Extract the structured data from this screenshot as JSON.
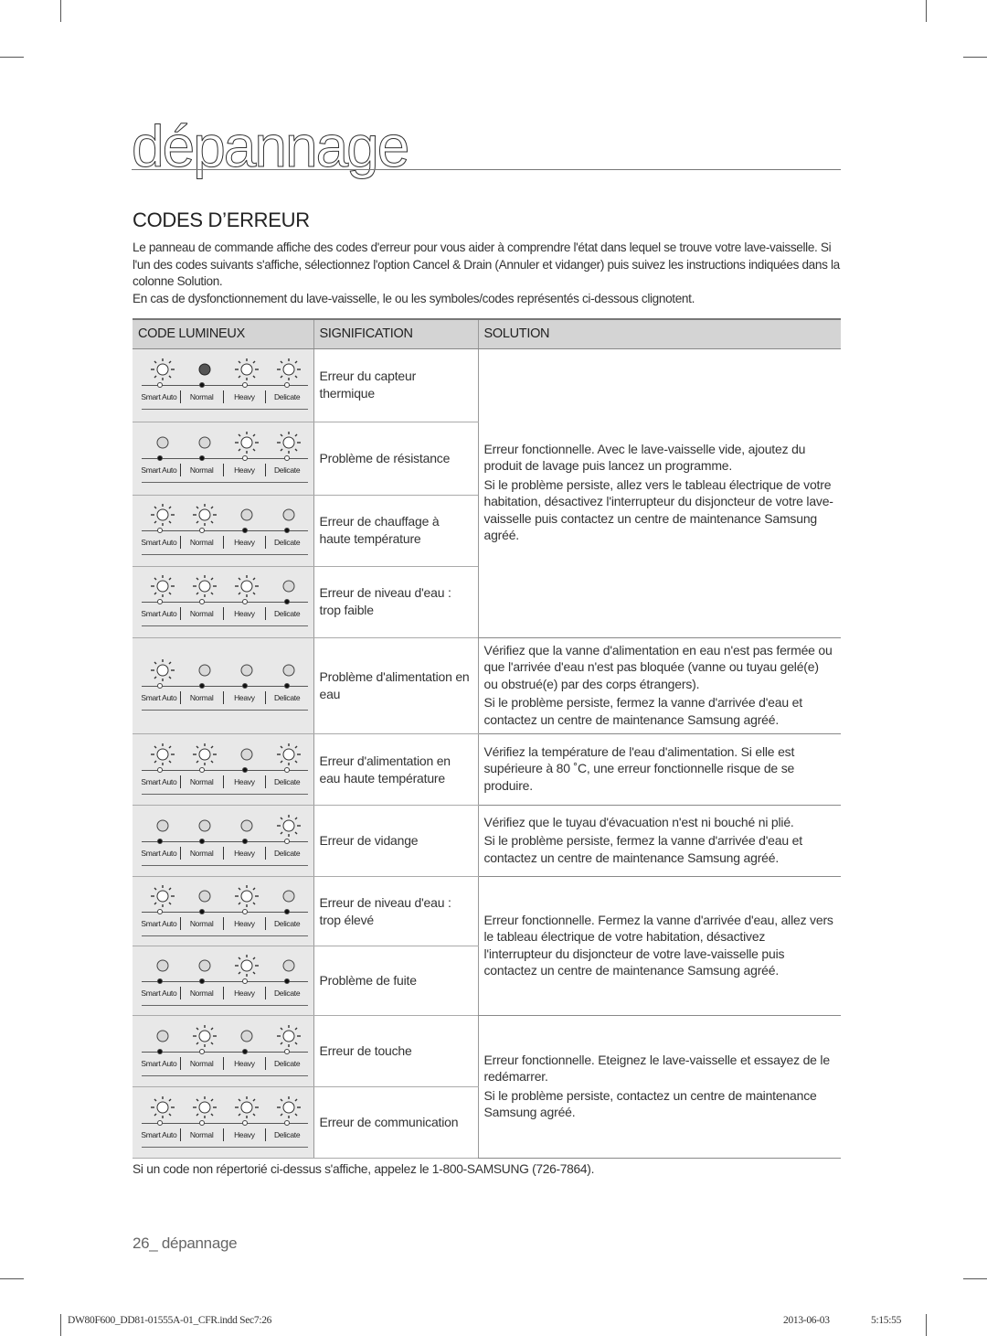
{
  "chapter_title": "dépannage",
  "section_title": "CODES D’ERREUR",
  "intro": [
    "Le panneau de commande affiche des codes d'erreur pour vous aider à comprendre l'état dans lequel se trouve votre lave-vaisselle. Si l'un des codes suivants s'affiche, sélectionnez l'option Cancel & Drain (Annuler et vidanger) puis suivez les instructions indiquées dans la colonne Solution.",
    "En cas de dysfonctionnement du lave-vaisselle, le ou les symboles/codes représentés ci-dessous clignotent."
  ],
  "table": {
    "headers": [
      "CODE LUMINEUX",
      "SIGNIFICATION",
      "SOLUTION"
    ],
    "panel_labels": [
      "Smart Auto",
      "Normal",
      "Heavy",
      "Delicate"
    ],
    "rows": [
      {
        "leds": [
          "blink",
          "on",
          "blink",
          "blink"
        ],
        "meaning": "Erreur du capteur thermique"
      },
      {
        "leds": [
          "off",
          "off",
          "blink",
          "blink"
        ],
        "meaning": "Problème de résistance"
      },
      {
        "leds": [
          "blink",
          "blink",
          "off",
          "off"
        ],
        "meaning": "Erreur de chauffage à haute température"
      },
      {
        "leds": [
          "blink",
          "blink",
          "blink",
          "off"
        ],
        "meaning": "Erreur de niveau d'eau : trop faible"
      },
      {
        "leds": [
          "blink",
          "off",
          "off",
          "off"
        ],
        "meaning": "Problème d'alimentation en eau"
      },
      {
        "leds": [
          "blink",
          "blink",
          "off",
          "blink"
        ],
        "meaning": "Erreur d'alimentation en eau haute température"
      },
      {
        "leds": [
          "off",
          "off",
          "off",
          "blink"
        ],
        "meaning": "Erreur de vidange"
      },
      {
        "leds": [
          "blink",
          "off",
          "blink",
          "off"
        ],
        "meaning": "Erreur de niveau d'eau : trop élevé"
      },
      {
        "leds": [
          "off",
          "off",
          "blink",
          "off"
        ],
        "meaning": "Problème de fuite"
      },
      {
        "leds": [
          "off",
          "blink",
          "off",
          "blink"
        ],
        "meaning": "Erreur de touche"
      },
      {
        "leds": [
          "blink",
          "blink",
          "blink",
          "blink"
        ],
        "meaning": "Erreur de communication"
      }
    ],
    "solutions": [
      {
        "rows": [
          0,
          1,
          2,
          3
        ],
        "paragraphs": [
          "Erreur fonctionnelle. Avec le lave-vaisselle vide, ajoutez du produit de lavage puis lancez un programme.",
          "Si le problème persiste, allez vers le tableau électrique de votre habitation, désactivez l'interrupteur du disjoncteur de votre lave-vaisselle puis contactez un centre de maintenance Samsung agréé."
        ]
      },
      {
        "rows": [
          4
        ],
        "paragraphs": [
          "Vérifiez que la vanne d'alimentation en eau n'est pas fermée ou que l'arrivée d'eau n'est pas bloquée (vanne ou tuyau gelé(e) ou obstrué(e) par des corps étrangers).",
          "Si le problème persiste, fermez la vanne d'arrivée d'eau et contactez un centre de maintenance Samsung agréé."
        ]
      },
      {
        "rows": [
          5
        ],
        "paragraphs": [
          "Vérifiez la température de l'eau d'alimentation. Si elle est supérieure à 80 ˚C, une erreur fonctionnelle risque de se produire."
        ]
      },
      {
        "rows": [
          6
        ],
        "paragraphs": [
          "Vérifiez que le tuyau d'évacuation n'est ni bouché ni plié.",
          "Si le problème persiste, fermez la vanne d'arrivée d'eau et contactez un centre de maintenance Samsung agréé."
        ]
      },
      {
        "rows": [
          7,
          8
        ],
        "paragraphs": [
          "Erreur fonctionnelle. Fermez la vanne d'arrivée d'eau, allez vers le tableau électrique de votre habitation, désactivez l'interrupteur du disjoncteur de votre lave-vaisselle puis contactez un centre de maintenance Samsung agréé."
        ]
      },
      {
        "rows": [
          9,
          10
        ],
        "paragraphs": [
          "Erreur fonctionnelle. Eteignez le lave-vaisselle et essayez de le redémarrer.",
          "Si le problème persiste, contactez un centre de maintenance Samsung agréé."
        ]
      }
    ]
  },
  "final_note": "Si un code non répertorié ci-dessus s'affiche, appelez le 1-800-SAMSUNG (726-7864).",
  "page_footer": "26_ dépannage",
  "slug": {
    "file": "DW80F600_DD81-01555A-01_CFR.indd   Sec7:26",
    "date": "2013-06-03",
    "time": "5:15:55"
  }
}
